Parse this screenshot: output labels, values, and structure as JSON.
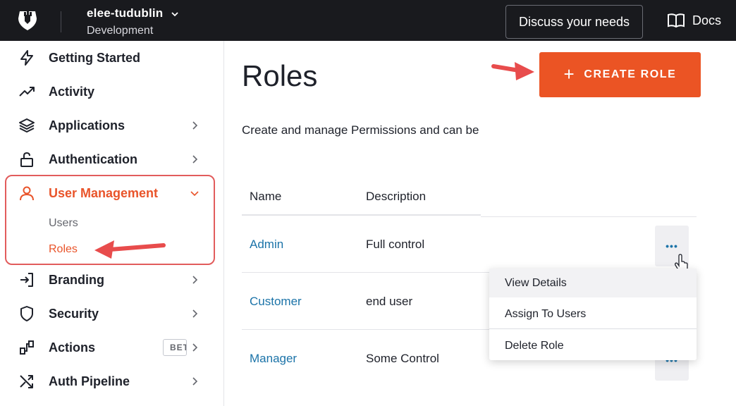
{
  "topbar": {
    "tenant_name": "elee-tudublin",
    "tenant_env": "Development",
    "discuss_label": "Discuss your needs",
    "docs_label": "Docs"
  },
  "sidebar": {
    "items": [
      {
        "label": "Getting Started",
        "icon": "lightning-icon"
      },
      {
        "label": "Activity",
        "icon": "trending-up-icon"
      },
      {
        "label": "Applications",
        "icon": "layers-icon"
      },
      {
        "label": "Authentication",
        "icon": "lock-icon"
      },
      {
        "label": "User Management",
        "icon": "user-icon"
      },
      {
        "label": "Branding",
        "icon": "sign-in-icon"
      },
      {
        "label": "Security",
        "icon": "shield-icon"
      },
      {
        "label": "Actions",
        "icon": "actions-flow-icon"
      },
      {
        "label": "Auth Pipeline",
        "icon": "shuffle-icon"
      }
    ],
    "sub_items": [
      {
        "label": "Users"
      },
      {
        "label": "Roles"
      }
    ],
    "beta_label": "BETA"
  },
  "main": {
    "title": "Roles",
    "create_label": "CREATE ROLE",
    "subtitle": "Create and manage Permissions and can be",
    "table": {
      "headers": [
        "Name",
        "Description"
      ],
      "rows": [
        {
          "name": "Admin",
          "description": "Full control"
        },
        {
          "name": "Customer",
          "description": "end user"
        },
        {
          "name": "Manager",
          "description": "Some Control"
        }
      ]
    },
    "more_label": "•••",
    "menu": [
      {
        "label": "View Details"
      },
      {
        "label": "Assign To Users"
      },
      {
        "label": "Delete Role"
      }
    ]
  },
  "colors": {
    "accent": "#eb5424",
    "active_nav": "#e9542a",
    "link": "#1b73a8",
    "annotation": "#e25c5c",
    "topbar": "#191a1e"
  }
}
